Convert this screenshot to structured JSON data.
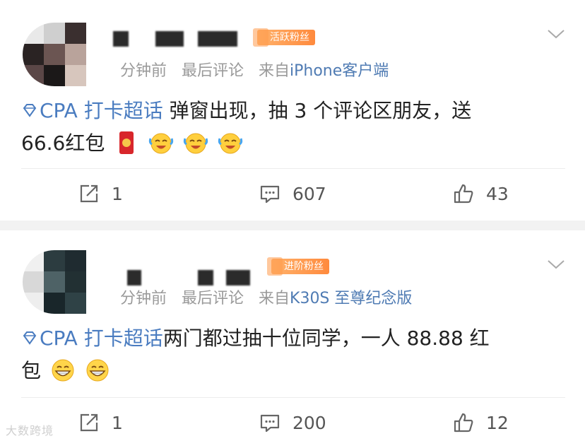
{
  "posts": [
    {
      "fan_badge": "活跃粉丝",
      "time": "分钟前",
      "sort": "最后评论",
      "source_prefix": "来自",
      "source": "iPhone客户端",
      "topic": "CPA 打卡超话",
      "text_line1": " 弹窗出现，抽 3 个评论区朋友，送",
      "text_line2": "66.6红包",
      "emojis": [
        "red-envelope-emoji",
        "crying-laughing-emoji",
        "crying-laughing-emoji",
        "crying-laughing-emoji"
      ],
      "reposts": "1",
      "comments": "607",
      "likes": "43"
    },
    {
      "fan_badge": "进阶粉丝",
      "time": "分钟前",
      "sort": "最后评论",
      "source_prefix": "来自",
      "source": "K30S 至尊纪念版",
      "topic": "CPA 打卡超话",
      "text_line1": "两门都过抽十位同学，一人 88.88 红",
      "text_line2": "包",
      "emojis": [
        "grinning-emoji",
        "grinning-emoji"
      ],
      "reposts": "1",
      "comments": "200",
      "likes": "12"
    }
  ],
  "watermark": "大数跨境",
  "colors": {
    "topic": "#4a7cc0",
    "source": "#4f7bb3",
    "meta": "#9a9a9a",
    "badge": "#ff8a3d"
  },
  "icons": [
    "diamond-icon",
    "chevron-down-icon",
    "repost-icon",
    "comment-icon",
    "like-icon"
  ]
}
